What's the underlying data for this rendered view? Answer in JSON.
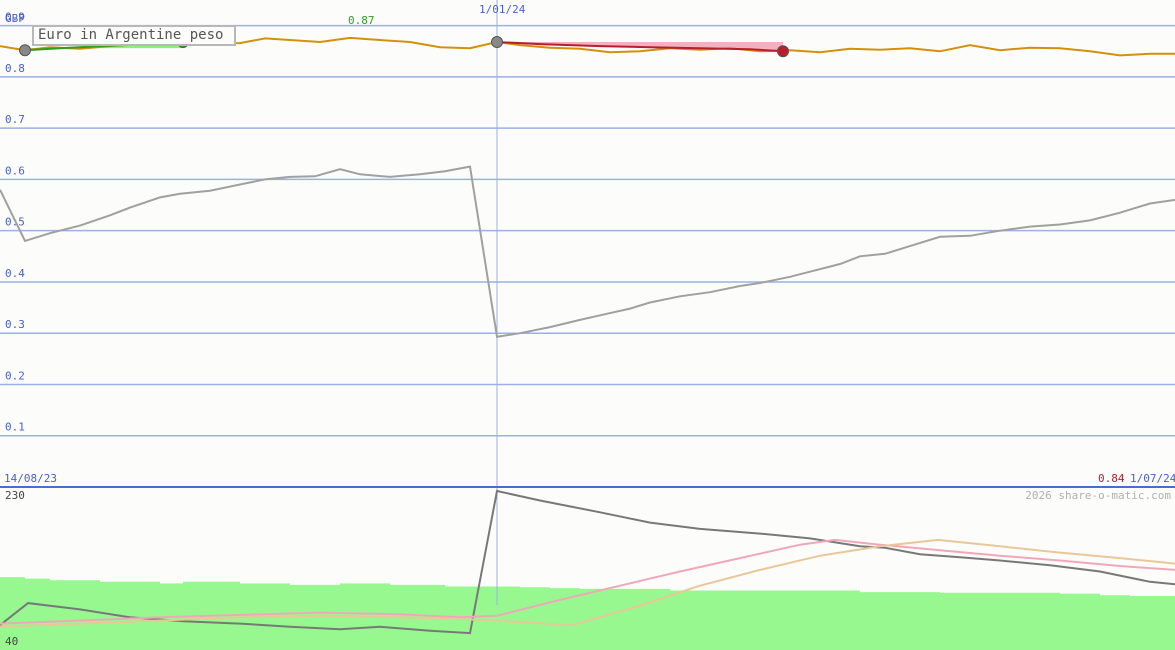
{
  "title": "Euro in Argentine peso",
  "currency_unit": "GBP",
  "start_date": "14/08/23",
  "mid_date": "1/01/24",
  "end_date": "1/07/24",
  "start_marker_value": "0.87",
  "end_marker_value": "0.84",
  "copyright": "2026 share-o-matic.com",
  "lower_scale_top": "230",
  "lower_scale_bottom": "40",
  "colors": {
    "main_line": "#d4900a",
    "gray_line": "#a0a0a0",
    "gain": "#2e9e1e",
    "gain_fill": "#8ef07a",
    "loss": "#b81e2c",
    "loss_fill": "#f4b0c0",
    "grid": "#9ab0e8",
    "axis_text": "#4a5fc8",
    "volume": "#98f890",
    "lower_dark": "#787878",
    "lower_pink": "#f0a8b8",
    "lower_tan": "#e8c898"
  },
  "chart_data": [
    {
      "type": "line",
      "name": "upper",
      "ylim": [
        0,
        0.95
      ],
      "yticks": [
        "0.1",
        "0.2",
        "0.3",
        "0.4",
        "0.5",
        "0.6",
        "0.7",
        "0.8",
        "0.9"
      ],
      "ytick_values": [
        0.1,
        0.2,
        0.3,
        0.4,
        0.5,
        0.6,
        0.7,
        0.8,
        0.9
      ],
      "xlim": [
        0,
        1175
      ],
      "series": [
        {
          "key": "main",
          "x": [
            0,
            25,
            50,
            80,
            110,
            140,
            160,
            183,
            210,
            240,
            265,
            290,
            320,
            350,
            380,
            410,
            440,
            470,
            497,
            520,
            550,
            580,
            610,
            640,
            670,
            700,
            730,
            760,
            790,
            820,
            850,
            880,
            910,
            940,
            970,
            1000,
            1030,
            1060,
            1090,
            1120,
            1150,
            1175
          ],
          "y": [
            0.86,
            0.852,
            0.858,
            0.855,
            0.86,
            0.865,
            0.866,
            0.868,
            0.865,
            0.866,
            0.875,
            0.872,
            0.868,
            0.876,
            0.872,
            0.868,
            0.858,
            0.856,
            0.868,
            0.862,
            0.857,
            0.855,
            0.848,
            0.85,
            0.856,
            0.853,
            0.856,
            0.85,
            0.852,
            0.848,
            0.855,
            0.853,
            0.856,
            0.85,
            0.862,
            0.852,
            0.857,
            0.856,
            0.85,
            0.842,
            0.845,
            0.845
          ]
        },
        {
          "key": "gray",
          "x": [
            0,
            25,
            50,
            80,
            110,
            130,
            160,
            180,
            210,
            240,
            265,
            290,
            315,
            340,
            360,
            390,
            420,
            445,
            470,
            497,
            520,
            550,
            580,
            600,
            630,
            650,
            680,
            710,
            740,
            760,
            790,
            810,
            840,
            860,
            885,
            910,
            940,
            970,
            1000,
            1030,
            1060,
            1090,
            1120,
            1150,
            1175
          ],
          "y": [
            0.58,
            0.48,
            0.495,
            0.51,
            0.53,
            0.545,
            0.565,
            0.572,
            0.578,
            0.59,
            0.6,
            0.605,
            0.606,
            0.62,
            0.61,
            0.605,
            0.61,
            0.616,
            0.625,
            0.293,
            0.3,
            0.312,
            0.326,
            0.335,
            0.348,
            0.36,
            0.372,
            0.38,
            0.392,
            0.398,
            0.41,
            0.42,
            0.435,
            0.45,
            0.455,
            0.47,
            0.488,
            0.49,
            0.5,
            0.508,
            0.512,
            0.52,
            0.535,
            0.553,
            0.56
          ]
        },
        {
          "key": "gain",
          "x": [
            25,
            60,
            100,
            150,
            183
          ],
          "y": [
            0.852,
            0.856,
            0.86,
            0.864,
            0.868
          ]
        },
        {
          "key": "loss",
          "x": [
            497,
            540,
            600,
            650,
            700,
            750,
            783
          ],
          "y": [
            0.868,
            0.864,
            0.86,
            0.858,
            0.856,
            0.854,
            0.85
          ]
        }
      ],
      "markers": [
        {
          "x": 25,
          "y": 0.852,
          "color": "#888888"
        },
        {
          "x": 183,
          "y": 0.868,
          "color": "#2e9e1e"
        },
        {
          "x": 497,
          "y": 0.868,
          "color": "#888888"
        },
        {
          "x": 783,
          "y": 0.85,
          "color": "#b81e2c"
        }
      ]
    },
    {
      "type": "line",
      "name": "lower",
      "ylim": [
        40,
        230
      ],
      "xlim": [
        0,
        1175
      ],
      "volume": {
        "x": [
          0,
          25,
          50,
          75,
          100,
          130,
          160,
          183,
          210,
          240,
          265,
          290,
          315,
          340,
          360,
          390,
          420,
          445,
          470,
          497,
          520,
          550,
          580,
          610,
          640,
          670,
          700,
          730,
          760,
          790,
          810,
          835,
          860,
          885,
          910,
          940,
          970,
          1000,
          1030,
          1060,
          1090,
          1100,
          1130,
          1150,
          1175
        ],
        "y": [
          121,
          119,
          117,
          117,
          115,
          115,
          113,
          115,
          115,
          113,
          113,
          111,
          111,
          113,
          113,
          111,
          111,
          109,
          109,
          109,
          108,
          107,
          106,
          106,
          106,
          104,
          104,
          104,
          104,
          104,
          104,
          104,
          102,
          102,
          102,
          101,
          101,
          101,
          101,
          100,
          100,
          98,
          97,
          97,
          96
        ]
      },
      "series": [
        {
          "key": "dark",
          "x": [
            0,
            28,
            80,
            130,
            183,
            240,
            290,
            340,
            380,
            430,
            470,
            497,
            540,
            600,
            650,
            700,
            760,
            810,
            860,
            885,
            920,
            960,
            1000,
            1050,
            1100,
            1150,
            1175
          ],
          "y": [
            60,
            88,
            80,
            70,
            65,
            62,
            58,
            55,
            58,
            53,
            50,
            230,
            218,
            203,
            190,
            182,
            176,
            170,
            160,
            158,
            150,
            146,
            142,
            136,
            128,
            115,
            112
          ]
        },
        {
          "key": "pink",
          "x": [
            0,
            80,
            160,
            240,
            320,
            400,
            460,
            497,
            560,
            620,
            680,
            740,
            800,
            835,
            880,
            940,
            1000,
            1060,
            1120,
            1175
          ],
          "y": [
            62,
            66,
            70,
            73,
            76,
            74,
            70,
            72,
            92,
            110,
            128,
            145,
            162,
            168,
            162,
            155,
            148,
            142,
            135,
            130
          ]
        },
        {
          "key": "tan",
          "x": [
            0,
            80,
            160,
            240,
            320,
            400,
            460,
            520,
            572,
            640,
            700,
            760,
            820,
            880,
            938,
            1000,
            1060,
            1120,
            1175
          ],
          "y": [
            58,
            62,
            66,
            70,
            72,
            70,
            68,
            64,
            60,
            85,
            110,
            130,
            148,
            160,
            168,
            160,
            152,
            145,
            138
          ]
        }
      ]
    }
  ]
}
